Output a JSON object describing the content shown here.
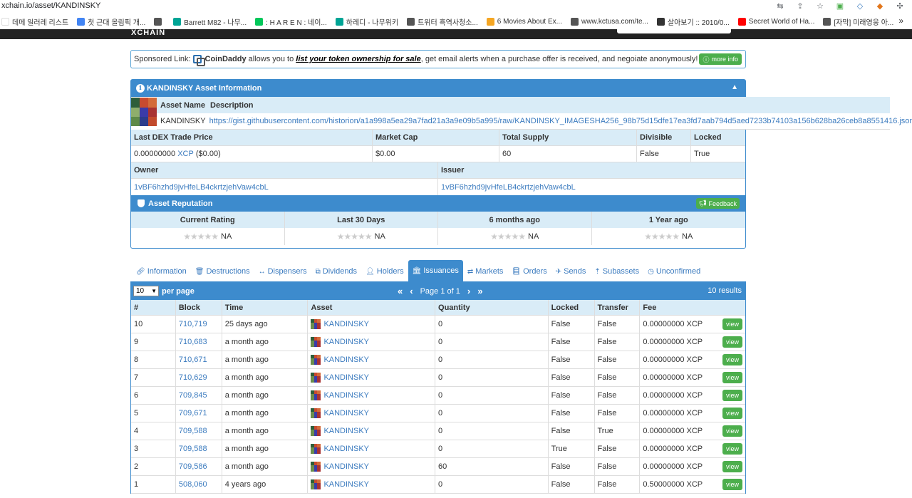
{
  "browser": {
    "url": "xchain.io/asset/KANDINSKY",
    "bookmarks": [
      {
        "label": "데메 일러레 리스트",
        "color": "#ffffff"
      },
      {
        "label": "첫 근대 올림픽 개...",
        "color": "#4285f4"
      },
      {
        "label": "",
        "color": "#555555"
      },
      {
        "label": "Barrett M82 - 나무...",
        "color": "#00a495"
      },
      {
        "label": ": H A R E N : 네이...",
        "color": "#03c75a"
      },
      {
        "label": "하레디 - 나무위키",
        "color": "#00a495"
      },
      {
        "label": "트위터 흑역사청소...",
        "color": "#555555"
      },
      {
        "label": "6 Movies About Ex...",
        "color": "#f5a623"
      },
      {
        "label": "www.kctusa.com/te...",
        "color": "#555555"
      },
      {
        "label": "살아보기 :: 2010/0...",
        "color": "#333333"
      },
      {
        "label": "Secret World of Ha...",
        "color": "#ff0000"
      },
      {
        "label": "[자막] 미래영웅 아...",
        "color": "#555555"
      }
    ],
    "more": "»"
  },
  "site": {
    "logo": "XCHAIN"
  },
  "sponsor": {
    "prefix": "Sponsored Link:",
    "brand": "CoinDaddy",
    "text1": "allows you to",
    "link": "list your token ownership for sale",
    "text2": ", get email alerts when a purchase offer is received, and negoiate anonymously!",
    "button": "more info"
  },
  "asset_info": {
    "title": "KANDINSKY Asset Information",
    "col_name": "Asset Name",
    "col_desc": "Description",
    "name": "KANDINSKY",
    "description": "https://gist.githubusercontent.com/historion/a1a998a5ea29a7fad21a3a9e09b5a995/raw/KANDINSKY_IMAGESHA256_98b75d15dfe17ea3fd7aab794d5aed7233b74103a156b628ba26ceb8a8551416.json",
    "h_price": "Last DEX Trade Price",
    "h_mcap": "Market Cap",
    "h_supply": "Total Supply",
    "h_divisible": "Divisible",
    "h_locked": "Locked",
    "price": "0.00000000",
    "price_unit": "XCP",
    "price_usd": "($0.00)",
    "mcap": "$0.00",
    "supply": "60",
    "divisible": "False",
    "locked": "True",
    "h_owner": "Owner",
    "h_issuer": "Issuer",
    "owner": "1vBF6hzhd9jvHfeLB4ckrtzjehVaw4cbL",
    "issuer": "1vBF6hzhd9jvHfeLB4ckrtzjehVaw4cbL"
  },
  "reputation": {
    "title": "Asset Reputation",
    "feedback": "Feedback",
    "cols": [
      {
        "label": "Current Rating",
        "value": "NA"
      },
      {
        "label": "Last 30 Days",
        "value": "NA"
      },
      {
        "label": "6 months ago",
        "value": "NA"
      },
      {
        "label": "1 Year ago",
        "value": "NA"
      }
    ]
  },
  "tabs": [
    {
      "label": "Information",
      "icon": "link"
    },
    {
      "label": "Destructions",
      "icon": "trash"
    },
    {
      "label": "Dispensers",
      "icon": "arrows-h"
    },
    {
      "label": "Dividends",
      "icon": "sitemap"
    },
    {
      "label": "Holders",
      "icon": "user"
    },
    {
      "label": "Issuances",
      "icon": "bank"
    },
    {
      "label": "Markets",
      "icon": "exchange"
    },
    {
      "label": "Orders",
      "icon": "book"
    },
    {
      "label": "Sends",
      "icon": "paper-plane"
    },
    {
      "label": "Subassets",
      "icon": "arrow-up"
    },
    {
      "label": "Unconfirmed",
      "icon": "clock"
    }
  ],
  "pager": {
    "per_page_value": "10",
    "per_page_label": "per page",
    "page_text": "Page 1 of 1",
    "results": "10 results"
  },
  "table": {
    "headers": [
      "#",
      "Block",
      "Time",
      "Asset",
      "Quantity",
      "Locked",
      "Transfer",
      "Fee"
    ],
    "view_label": "view",
    "rows": [
      {
        "num": "10",
        "block": "710,719",
        "time": "25 days ago",
        "asset": "KANDINSKY",
        "qty": "0",
        "locked": "False",
        "transfer": "False",
        "fee": "0.00000000 XCP"
      },
      {
        "num": "9",
        "block": "710,683",
        "time": "a month ago",
        "asset": "KANDINSKY",
        "qty": "0",
        "locked": "False",
        "transfer": "False",
        "fee": "0.00000000 XCP"
      },
      {
        "num": "8",
        "block": "710,671",
        "time": "a month ago",
        "asset": "KANDINSKY",
        "qty": "0",
        "locked": "False",
        "transfer": "False",
        "fee": "0.00000000 XCP"
      },
      {
        "num": "7",
        "block": "710,629",
        "time": "a month ago",
        "asset": "KANDINSKY",
        "qty": "0",
        "locked": "False",
        "transfer": "False",
        "fee": "0.00000000 XCP"
      },
      {
        "num": "6",
        "block": "709,845",
        "time": "a month ago",
        "asset": "KANDINSKY",
        "qty": "0",
        "locked": "False",
        "transfer": "False",
        "fee": "0.00000000 XCP"
      },
      {
        "num": "5",
        "block": "709,671",
        "time": "a month ago",
        "asset": "KANDINSKY",
        "qty": "0",
        "locked": "False",
        "transfer": "False",
        "fee": "0.00000000 XCP"
      },
      {
        "num": "4",
        "block": "709,588",
        "time": "a month ago",
        "asset": "KANDINSKY",
        "qty": "0",
        "locked": "False",
        "transfer": "True",
        "fee": "0.00000000 XCP"
      },
      {
        "num": "3",
        "block": "709,588",
        "time": "a month ago",
        "asset": "KANDINSKY",
        "qty": "0",
        "locked": "True",
        "transfer": "False",
        "fee": "0.00000000 XCP"
      },
      {
        "num": "2",
        "block": "709,586",
        "time": "a month ago",
        "asset": "KANDINSKY",
        "qty": "60",
        "locked": "False",
        "transfer": "False",
        "fee": "0.00000000 XCP"
      },
      {
        "num": "1",
        "block": "508,060",
        "time": "4 years ago",
        "asset": "KANDINSKY",
        "qty": "0",
        "locked": "False",
        "transfer": "False",
        "fee": "0.50000000 XCP"
      }
    ]
  },
  "colors": {
    "panel_blue": "#3d8bcd",
    "head_light": "#d9ecf7",
    "link": "#3b7bbf",
    "green": "#4cae4c"
  }
}
